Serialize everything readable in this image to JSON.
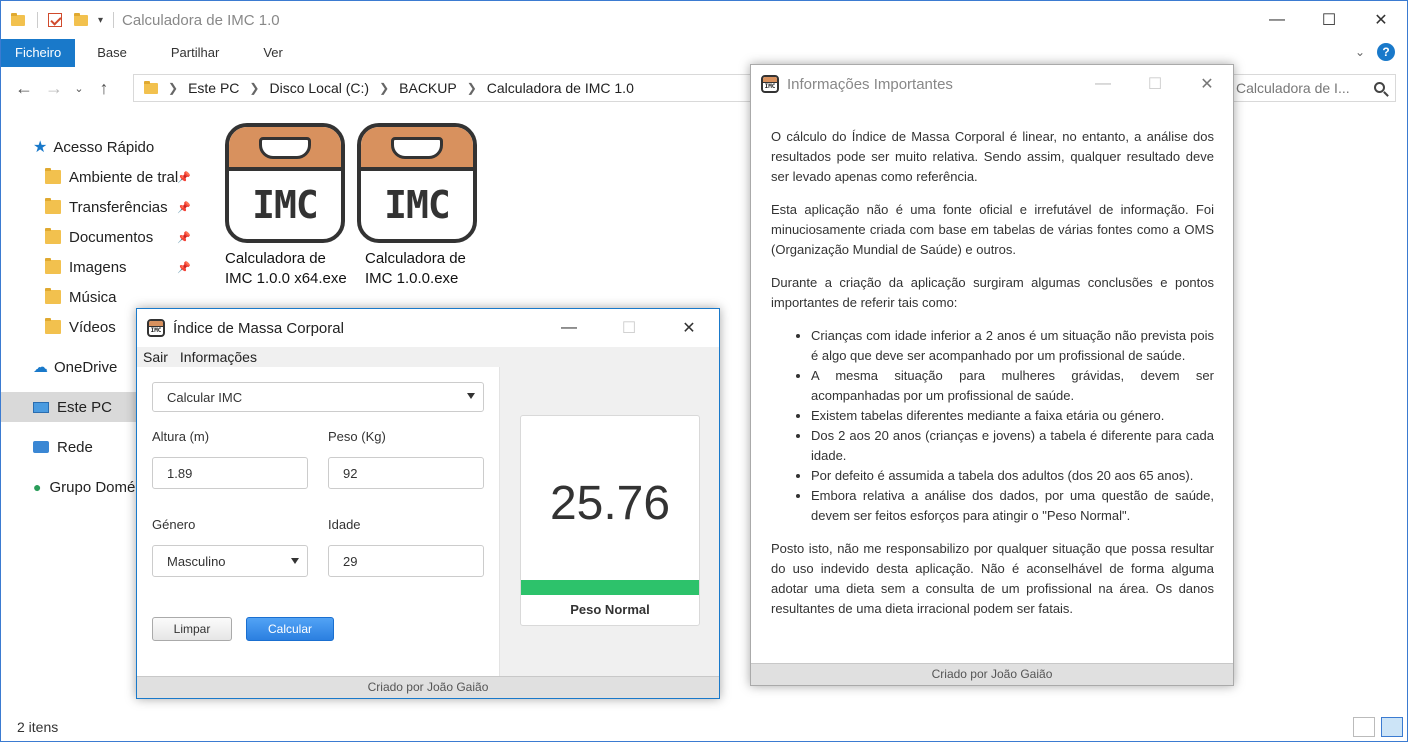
{
  "explorer": {
    "title": "Calculadora de IMC 1.0",
    "ribbon_tabs": [
      "Ficheiro",
      "Base",
      "Partilhar",
      "Ver"
    ],
    "breadcrumbs": [
      "Este PC",
      "Disco Local (C:)",
      "BACKUP",
      "Calculadora de IMC 1.0"
    ],
    "search_placeholder": "Calculadora de I...",
    "nav_items": [
      {
        "label": "Acesso Rápido",
        "icon": "star-icon"
      },
      {
        "label": "Ambiente de tral",
        "icon": "desktop-folder-icon",
        "pinned": true
      },
      {
        "label": "Transferências",
        "icon": "downloads-folder-icon",
        "pinned": true
      },
      {
        "label": "Documentos",
        "icon": "documents-folder-icon",
        "pinned": true
      },
      {
        "label": "Imagens",
        "icon": "pictures-folder-icon",
        "pinned": true
      },
      {
        "label": "Música",
        "icon": "music-folder-icon"
      },
      {
        "label": "Vídeos",
        "icon": "videos-folder-icon"
      },
      {
        "label": "OneDrive",
        "icon": "cloud-icon"
      },
      {
        "label": "Este PC",
        "icon": "computer-icon",
        "selected": true
      },
      {
        "label": "Rede",
        "icon": "network-icon"
      },
      {
        "label": "Grupo Domé",
        "icon": "homegroup-icon"
      }
    ],
    "files": [
      {
        "icon_text": "IMC",
        "line1": "Calculadora de",
        "line2": "IMC 1.0.0 x64.exe"
      },
      {
        "icon_text": "IMC",
        "line1": "Calculadora de",
        "line2": "IMC 1.0.0.exe"
      }
    ],
    "status": "2 itens"
  },
  "imc_window": {
    "title": "Índice de Massa Corporal",
    "menu": [
      "Sair",
      "Informações"
    ],
    "mode_select": "Calcular IMC",
    "labels": {
      "altura": "Altura (m)",
      "peso": "Peso (Kg)",
      "genero": "Género",
      "idade": "Idade"
    },
    "values": {
      "altura": "1.89",
      "peso": "92",
      "genero": "Masculino",
      "idade": "29"
    },
    "buttons": {
      "limpar": "Limpar",
      "calcular": "Calcular"
    },
    "result": {
      "value": "25.76",
      "label": "Peso Normal",
      "color": "#2dc26b"
    },
    "footer": "Criado por João Gaião"
  },
  "info_window": {
    "title": "Informações Importantes",
    "paragraphs": [
      "O cálculo do Índice de Massa Corporal é linear, no entanto, a análise dos resultados pode ser muito relativa. Sendo assim, qualquer resultado deve ser levado apenas como referência.",
      "Esta aplicação não é uma fonte oficial e irrefutável de informação. Foi minuciosamente criada com base em tabelas de várias fontes como a OMS (Organização Mundial de Saúde) e outros.",
      "Durante a criação da aplicação surgiram algumas conclusões e pontos importantes de referir tais como:"
    ],
    "bullets": [
      "Crianças com idade inferior a 2 anos é um situação não prevista pois é algo que deve ser acompanhado por um profissional de saúde.",
      "A mesma situação para mulheres grávidas, devem ser acompanhadas por um profissional de saúde.",
      "Existem tabelas diferentes mediante a faixa etária ou género.",
      "Dos 2 aos 20 anos (crianças e jovens) a tabela é diferente para cada idade.",
      "Por defeito é assumida a tabela dos adultos (dos 20 aos 65 anos).",
      "Embora relativa a análise dos dados, por uma questão de saúde, devem ser feitos esforços para atingir o \"Peso Normal\"."
    ],
    "closing": "Posto isto, não me responsabilizo por qualquer situação que possa resultar do uso indevido desta aplicação. Não é aconselhável de forma alguma adotar uma dieta sem a consulta de um profissional na área. Os danos resultantes de uma dieta irracional podem ser fatais.",
    "footer": "Criado por João Gaião"
  }
}
